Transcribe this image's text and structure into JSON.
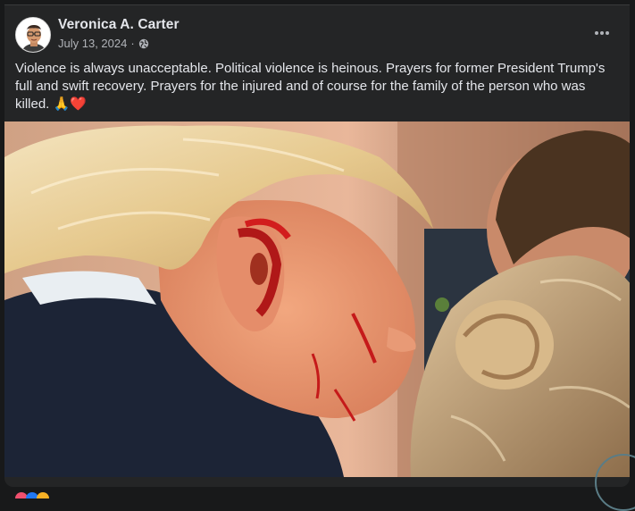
{
  "post": {
    "author": "Veronica A. Carter",
    "date": "July 13, 2024",
    "separator": "·",
    "privacy_icon": "globe-icon",
    "more_icon": "more-options-icon",
    "caption": "Violence is always unacceptable. Political violence is heinous. Prayers for former President Trump's full and swift recovery. Prayers for the injured and of course for the family of the person who was killed. 🙏❤️",
    "photo_alt": "news photo"
  },
  "colors": {
    "background": "#18191a",
    "card": "#242526",
    "text_primary": "#e4e6eb",
    "text_secondary": "#b0b3b8"
  }
}
